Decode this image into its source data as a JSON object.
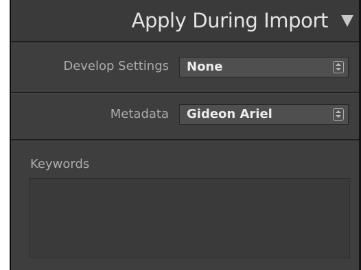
{
  "header": {
    "title": "Apply During Import",
    "collapse_icon": "triangle-down-icon"
  },
  "develop_settings": {
    "label": "Develop Settings",
    "value": "None",
    "stepper_icon": "up-down-stepper-icon"
  },
  "metadata": {
    "label": "Metadata",
    "value": "Gideon Ariel",
    "stepper_icon": "up-down-stepper-icon"
  },
  "keywords": {
    "label": "Keywords",
    "value": ""
  },
  "colors": {
    "panel_bg": "#3e3e3e",
    "header_bg": "#3a3a3a",
    "select_bg": "#4f4f4f",
    "text_light": "#e3e3e3",
    "text_label": "#acacac"
  }
}
